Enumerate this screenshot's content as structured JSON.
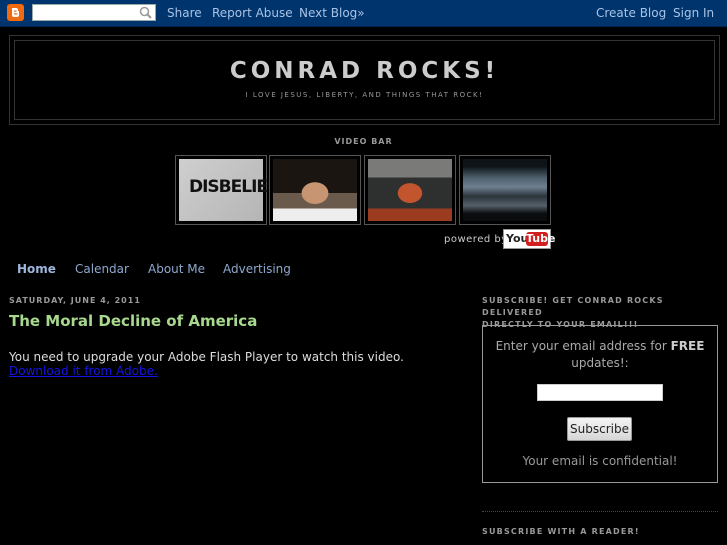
{
  "navbar": {
    "logo": "blogger-logo",
    "search_placeholder": "",
    "links": [
      "Share",
      "Report Abuse",
      "Next Blog»"
    ],
    "right_links": [
      "Create Blog",
      "Sign In"
    ],
    "bg_color": "#00346c"
  },
  "header": {
    "title": "CONRAD ROCKS!",
    "description": "I LOVE JESUS, LIBERTY, AND THINGS THAT ROCK!"
  },
  "video_bar": {
    "title": "VIDEO BAR",
    "thumbnails": [
      {
        "label": "Disbelief video"
      },
      {
        "label": "Man in cap video"
      },
      {
        "label": "Man in studio video"
      },
      {
        "label": "Cloudy sky video"
      }
    ],
    "powered_by": "powered by",
    "yt_you": "You",
    "yt_tube": "Tube"
  },
  "tabs": [
    {
      "label": "Home",
      "active": true
    },
    {
      "label": "Calendar",
      "active": false
    },
    {
      "label": "About Me",
      "active": false
    },
    {
      "label": "Advertising",
      "active": false
    }
  ],
  "post": {
    "date": "SATURDAY, JUNE 4, 2011",
    "title": "The Moral Decline of America",
    "body": "You need to upgrade your Adobe Flash Player to watch this video.",
    "link": "Download it from Adobe.",
    "title_color": "#a7d88e"
  },
  "sidebar": {
    "subscribe_heading_line1": "SUBSCRIBE! GET CONRAD ROCKS DELIVERED",
    "subscribe_heading_line2": "DIRECTLY TO YOUR EMAIL!!!",
    "prompt_pre": "Enter your email address for ",
    "prompt_bold": "FREE",
    "prompt_post": " updates!:",
    "email_value": "",
    "subscribe_button": "Subscribe",
    "confidential_note": "Your email is confidential!",
    "reader_heading": "SUBSCRIBE WITH A READER!"
  }
}
